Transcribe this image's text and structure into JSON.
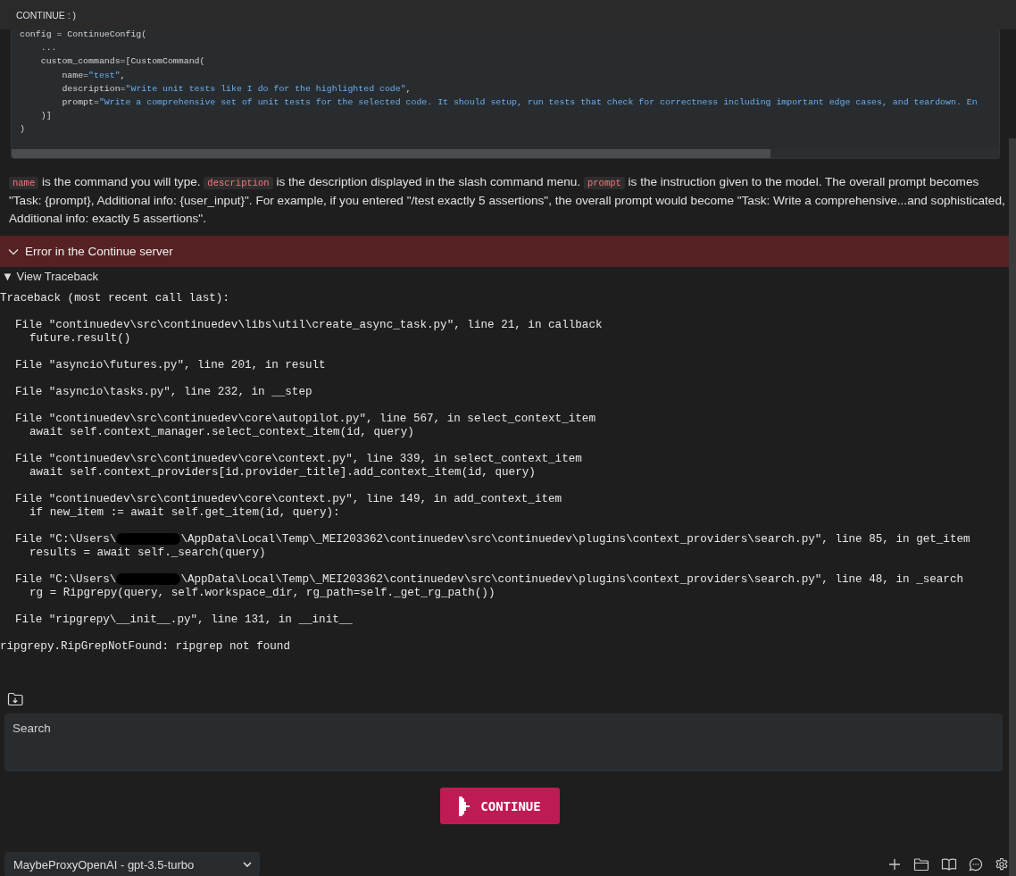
{
  "top_bar": {
    "title": "CONTINUE : )"
  },
  "code_block": {
    "lines": [
      [
        {
          "kind": "plain",
          "text": "config = ContinueConfig("
        }
      ],
      [
        {
          "kind": "plain",
          "text": "    ..."
        }
      ],
      [
        {
          "kind": "plain",
          "text": "    custom_commands=[CustomCommand("
        }
      ],
      [
        {
          "kind": "plain",
          "text": "        name="
        },
        {
          "kind": "string",
          "text": "\"test\""
        },
        {
          "kind": "plain",
          "text": ","
        }
      ],
      [
        {
          "kind": "plain",
          "text": "        description="
        },
        {
          "kind": "string",
          "text": "\"Write unit tests like I do for the highlighted code\""
        },
        {
          "kind": "plain",
          "text": ","
        }
      ],
      [
        {
          "kind": "plain",
          "text": "        prompt="
        },
        {
          "kind": "string",
          "text": "\"Write a comprehensive set of unit tests for the selected code. It should setup, run tests that check for correctness including important edge cases, and teardown. En"
        }
      ],
      [
        {
          "kind": "plain",
          "text": "    )]"
        }
      ],
      [
        {
          "kind": "plain",
          "text": ")"
        }
      ]
    ]
  },
  "paragraph": [
    {
      "kind": "code",
      "text": "name"
    },
    {
      "kind": "text",
      "text": " is the command you will type. "
    },
    {
      "kind": "code",
      "text": "description"
    },
    {
      "kind": "text",
      "text": " is the description displayed in the slash command menu. "
    },
    {
      "kind": "code",
      "text": "prompt"
    },
    {
      "kind": "text",
      "text": " is the instruction given to the model. The overall prompt becomes \"Task: {prompt}, Additional info: {user_input}\". For example, if you entered \"/test exactly 5 assertions\", the overall prompt would become \"Task: Write a comprehensive...and sophisticated, Additional info: exactly 5 assertions\"."
    }
  ],
  "error_banner": {
    "title": "Error in the Continue server",
    "expanded": true
  },
  "traceback": {
    "toggle": "▼ View Traceback",
    "header": "Traceback (most recent call last):",
    "frames": [
      {
        "file": [
          "File \"continuedev\\src\\continuedev\\libs\\util\\create_async_task.py\", line 21, in callback"
        ],
        "code": "future.result()"
      },
      {
        "file": [
          "File \"asyncio\\futures.py\", line 201, in result"
        ]
      },
      {
        "file": [
          "File \"asyncio\\tasks.py\", line 232, in __step"
        ]
      },
      {
        "file": [
          "File \"continuedev\\src\\continuedev\\core\\autopilot.py\", line 567, in select_context_item"
        ],
        "code": "await self.context_manager.select_context_item(id, query)"
      },
      {
        "file": [
          "File \"continuedev\\src\\continuedev\\core\\context.py\", line 339, in select_context_item"
        ],
        "code": "await self.context_providers[id.provider_title].add_context_item(id, query)"
      },
      {
        "file": [
          "File \"continuedev\\src\\continuedev\\core\\context.py\", line 149, in add_context_item"
        ],
        "code": "if new_item := await self.get_item(id, query):"
      },
      {
        "file": [
          "File \"C:\\Users\\",
          "\\AppData\\Local\\Temp\\_MEI203362\\continuedev\\src\\continuedev\\plugins\\context_providers\\search.py\", line 85, in get_item"
        ],
        "code": "results = await self._search(query)"
      },
      {
        "file": [
          "File \"C:\\Users\\",
          "\\AppData\\Local\\Temp\\_MEI203362\\continuedev\\src\\continuedev\\plugins\\context_providers\\search.py\", line 48, in _search"
        ],
        "code": "rg = Ripgrepy(query, self.workspace_dir, rg_path=self._get_rg_path())"
      },
      {
        "file": [
          "File \"ripgrepy\\__init__.py\", line 131, in __init__"
        ]
      }
    ],
    "error": "ripgrepy.RipGrepNotFound: ripgrep not found"
  },
  "search": {
    "placeholder": "Search"
  },
  "continue_button": {
    "label": "CONTINUE"
  },
  "model_select": {
    "value": "MaybeProxyOpenAI - gpt-3.5-turbo"
  }
}
